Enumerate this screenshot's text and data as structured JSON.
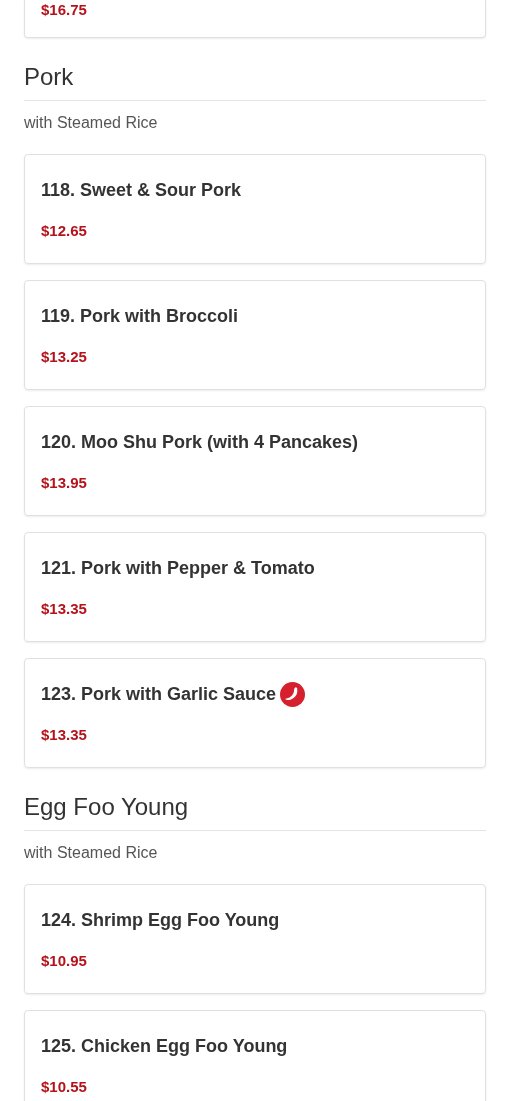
{
  "previous_item": {
    "price": "$16.75"
  },
  "sections": [
    {
      "title": "Pork",
      "subtitle": "with Steamed Rice",
      "items": [
        {
          "name": "118. Sweet & Sour Pork",
          "price": "$12.65",
          "spicy": false
        },
        {
          "name": "119. Pork with Broccoli",
          "price": "$13.25",
          "spicy": false
        },
        {
          "name": "120. Moo Shu Pork (with 4 Pancakes)",
          "price": "$13.95",
          "spicy": false
        },
        {
          "name": "121. Pork with Pepper & Tomato",
          "price": "$13.35",
          "spicy": false
        },
        {
          "name": "123. Pork with Garlic Sauce",
          "price": "$13.35",
          "spicy": true
        }
      ]
    },
    {
      "title": "Egg Foo Young",
      "subtitle": "with Steamed Rice",
      "items": [
        {
          "name": "124. Shrimp Egg Foo Young",
          "price": "$10.95",
          "spicy": false
        },
        {
          "name": "125. Chicken Egg Foo Young",
          "price": "$10.55",
          "spicy": false
        }
      ]
    }
  ]
}
